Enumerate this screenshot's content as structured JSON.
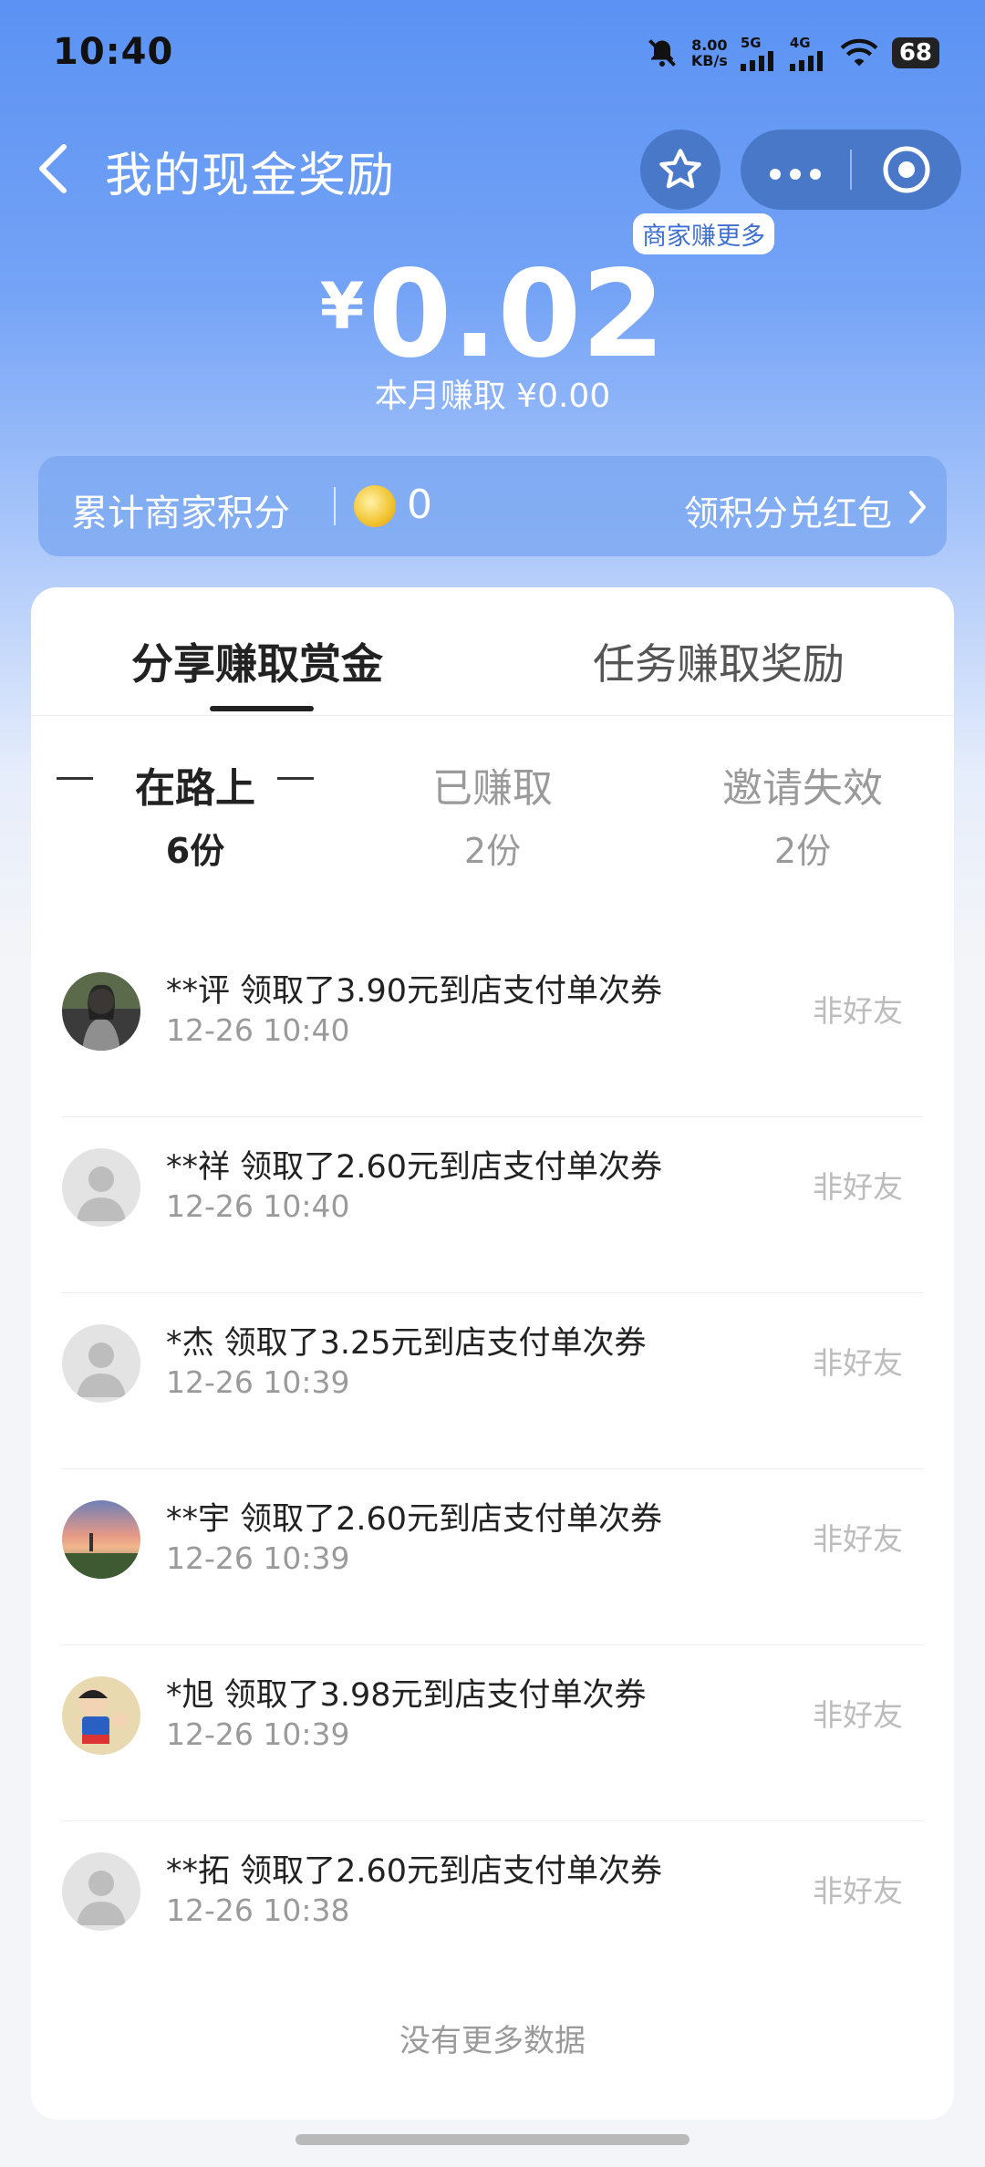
{
  "status_bar": {
    "time": "10:40",
    "speed_value": "8.00",
    "speed_unit": "KB/s",
    "net1": "5G",
    "net2": "4G",
    "battery": "68"
  },
  "nav": {
    "title": "我的现金奖励",
    "star_caption": "商家赚更多"
  },
  "summary": {
    "currency": "¥",
    "amount": "0.02",
    "monthly": "本月赚取 ¥0.00"
  },
  "points": {
    "label": "累计商家积分",
    "value": "0",
    "link": "领积分兑红包"
  },
  "tabs": [
    {
      "label": "分享赚取赏金",
      "active": true
    },
    {
      "label": "任务赚取奖励",
      "active": false
    }
  ],
  "filters": [
    {
      "name": "在路上",
      "count": "6份",
      "active": true
    },
    {
      "name": "已赚取",
      "count": "2份",
      "active": false
    },
    {
      "name": "邀请失效",
      "count": "2份",
      "active": false
    }
  ],
  "records": [
    {
      "text": "**评 领取了3.90元到店支付单次券",
      "time": "12-26 10:40",
      "tag": "非好友",
      "avatar": "photo-person"
    },
    {
      "text": "**祥 领取了2.60元到店支付单次券",
      "time": "12-26 10:40",
      "tag": "非好友",
      "avatar": "default"
    },
    {
      "text": "*杰 领取了3.25元到店支付单次券",
      "time": "12-26 10:39",
      "tag": "非好友",
      "avatar": "default"
    },
    {
      "text": "**宇 领取了2.60元到店支付单次券",
      "time": "12-26 10:39",
      "tag": "非好友",
      "avatar": "photo-sunset"
    },
    {
      "text": "*旭 领取了3.98元到店支付单次券",
      "time": "12-26 10:39",
      "tag": "非好友",
      "avatar": "photo-cartoon"
    },
    {
      "text": "**拓 领取了2.60元到店支付单次券",
      "time": "12-26 10:38",
      "tag": "非好友",
      "avatar": "default"
    }
  ],
  "footer": {
    "no_more": "没有更多数据"
  },
  "colors": {
    "header_blue": "#5b92f3",
    "capsule_blue": "#4a78c8",
    "card_bg": "#ffffff",
    "muted_text": "#9a9a9a"
  }
}
